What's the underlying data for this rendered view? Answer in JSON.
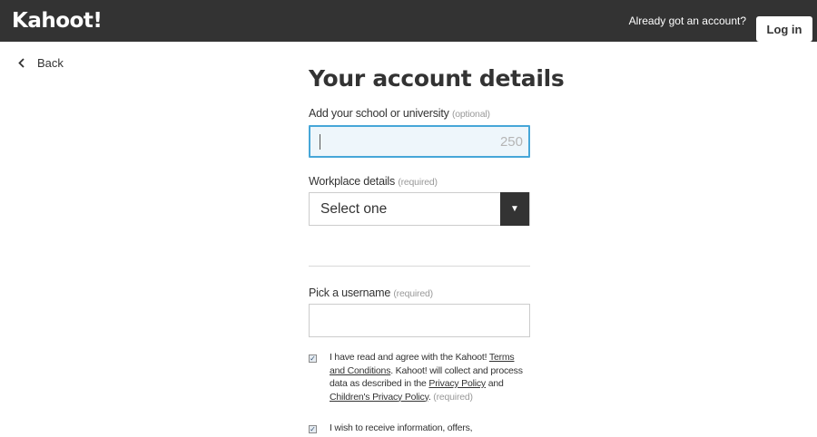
{
  "header": {
    "logo": "Kahoot!",
    "already_text": "Already got an account?",
    "login_label": "Log in"
  },
  "back_label": "Back",
  "form": {
    "title": "Your account details",
    "school": {
      "label": "Add your school or university",
      "hint": "(optional)",
      "value": "",
      "counter": "250"
    },
    "workplace": {
      "label": "Workplace details",
      "hint": "(required)",
      "selected": "Select one"
    },
    "username": {
      "label": "Pick a username",
      "hint": "(required)",
      "value": ""
    },
    "terms": {
      "text1": "I have read and agree with the Kahoot! ",
      "terms_link": "Terms and Conditions",
      "text2": ". Kahoot! will collect and process data as described in the ",
      "privacy_link": "Privacy Policy",
      "text3": " and ",
      "children_link": "Children's Privacy Policy",
      "text4": ".",
      "hint": "(required)",
      "checked": true
    },
    "marketing": {
      "text": "I wish to receive information, offers,",
      "checked": true
    }
  },
  "icons": {
    "back": "chevron-left-icon",
    "select": "caret-down-icon",
    "check": "check-icon"
  },
  "colors": {
    "header_bg": "#333333",
    "input_focus_border": "#46a6d8",
    "input_focus_bg": "#eef6fb"
  }
}
